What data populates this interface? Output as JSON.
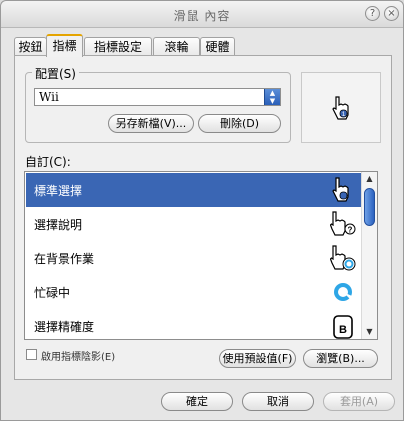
{
  "window": {
    "title": "滑鼠 內容"
  },
  "tabs": [
    {
      "label": "按鈕"
    },
    {
      "label": "指標",
      "active": true
    },
    {
      "label": "指標設定"
    },
    {
      "label": "滾輪"
    },
    {
      "label": "硬體"
    }
  ],
  "scheme": {
    "label": "配置(S)",
    "selected": "Wii",
    "save_as_label": "另存新檔(V)...",
    "delete_label": "刪除(D)"
  },
  "customize": {
    "label": "自訂(C):",
    "items": [
      {
        "label": "標準選擇",
        "icon": "hand-pointer-icon",
        "selected": true
      },
      {
        "label": "選擇說明",
        "icon": "hand-help-icon"
      },
      {
        "label": "在背景作業",
        "icon": "hand-busy-icon"
      },
      {
        "label": "忙碌中",
        "icon": "busy-ring-icon"
      },
      {
        "label": "選擇精確度",
        "icon": "precision-b-icon"
      }
    ]
  },
  "shadow_checkbox": {
    "label": "啟用指標陰影(E)",
    "checked": false
  },
  "use_default_label": "使用預設值(F)",
  "browse_label": "瀏覽(B)...",
  "footer": {
    "ok_label": "確定",
    "cancel_label": "取消",
    "apply_label": "套用(A)"
  },
  "colors": {
    "selection": "#3a66b4",
    "tab_accent": "#e5a400",
    "scroll_thumb": "#2c62c0"
  }
}
